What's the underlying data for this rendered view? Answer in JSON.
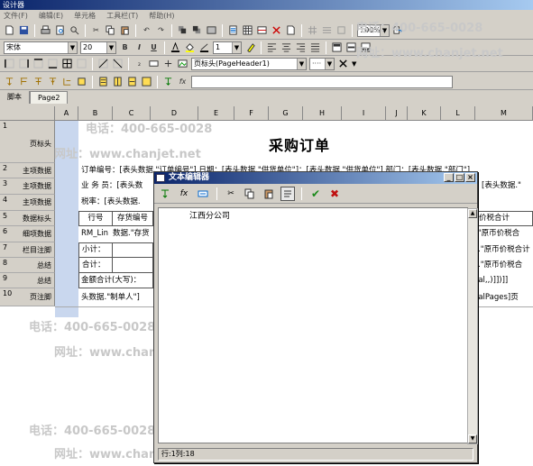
{
  "app": {
    "title": "设计器"
  },
  "menu": [
    "文件(F)",
    "编辑(E)",
    "单元格",
    "工具栏(T)",
    "帮助(H)"
  ],
  "toolbar": {
    "zoom": "100%",
    "font_name": "宋体",
    "font_size": "20",
    "bold": "B",
    "italic": "I",
    "underline": "U",
    "line_width": "1",
    "band_select": "页标头(PageHeader1)",
    "fx_label": "fx",
    "formula_value": ""
  },
  "tabs": [
    "脚本",
    "Page2"
  ],
  "grid": {
    "columns": [
      "A",
      "B",
      "C",
      "D",
      "E",
      "F",
      "G",
      "H",
      "I",
      "J",
      "K",
      "L",
      "M"
    ],
    "rows": [
      {
        "num": "1",
        "label": "页标头"
      },
      {
        "num": "2",
        "label": "主项数据"
      },
      {
        "num": "3",
        "label": "主项数据"
      },
      {
        "num": "4",
        "label": "主项数据"
      },
      {
        "num": "5",
        "label": "数据标头"
      },
      {
        "num": "6",
        "label": "细项数据"
      },
      {
        "num": "7",
        "label": "栏目注脚"
      },
      {
        "num": "8",
        "label": "总结"
      },
      {
        "num": "9",
        "label": "总结"
      },
      {
        "num": "10",
        "label": "页注脚"
      }
    ],
    "report_title": "采购订单",
    "cells": {
      "r2": "订单编号：[表头数据.\"订单编号\"] 日期：[表头数据.\"供货单位\"]：[表头数据.\"供货单位\"] 部门：[表头数据.\"部门\"]",
      "r3_left": "业 务 员：[表头数",
      "r3_right": "[表头数据.\"",
      "r4": "税率：[表头数据.",
      "r5_c1": "行号",
      "r5_c2": "存货编号",
      "r5_right": "价税合计",
      "r6_left": "RM_Lin",
      "r6_mid": "数据.\"存货",
      "r6_right": ".\"原币价税合",
      "r7_left": "小计：",
      "r7_right": ".\"原币价税合计",
      "r8_left": "合计：",
      "r8_right": ".\"原币价税合",
      "r9_left": "金额合计(大写)：",
      "r9_right": "tal,,)]])]]",
      "r10_left": "头数据.\"制单人\"]",
      "r10_right": "talPages]页"
    }
  },
  "watermark": {
    "phone": "电话：400-665-0028",
    "site": "网址：www.chanjet.net"
  },
  "dialog": {
    "title": "文本编辑器",
    "content": "江西分公司",
    "status": "行:1列:18",
    "ok": "✔",
    "cancel": "✖"
  }
}
